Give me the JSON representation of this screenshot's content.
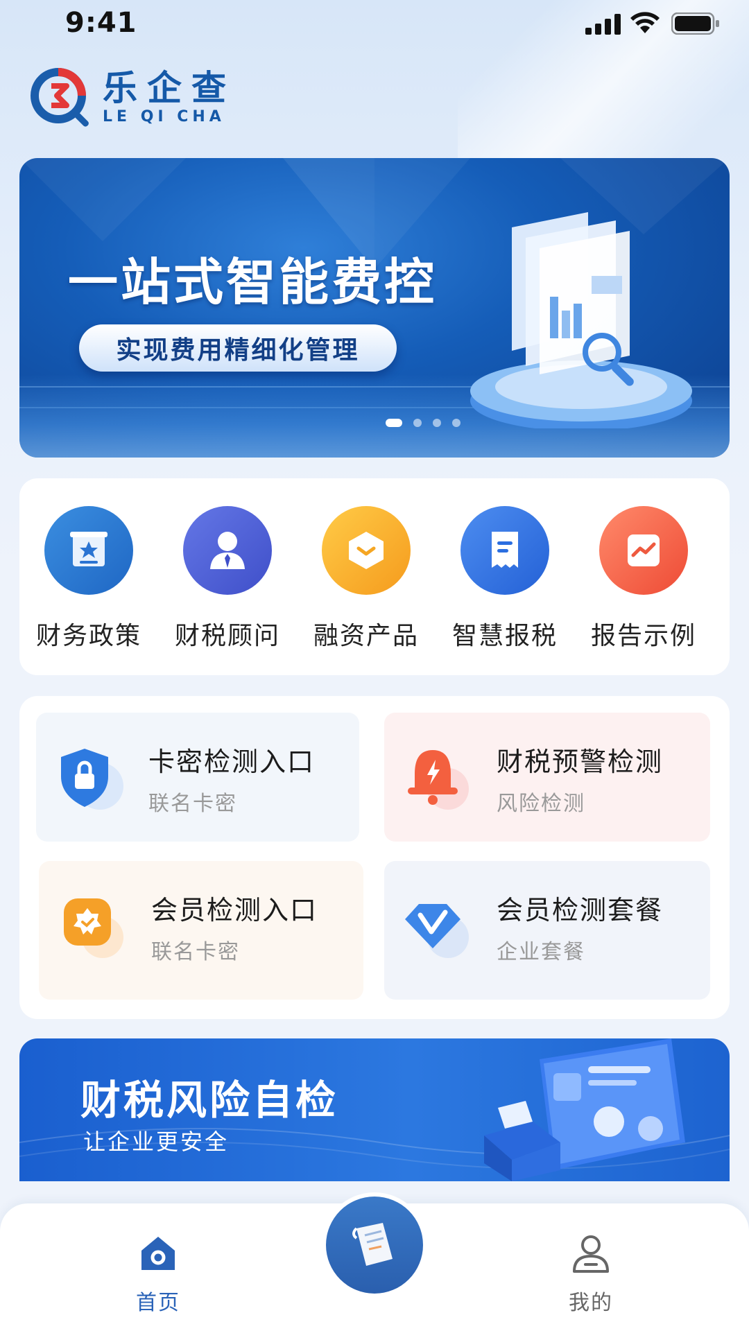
{
  "status_bar": {
    "time": "9:41"
  },
  "logo": {
    "cn": "乐企查",
    "en": "LE QI CHA"
  },
  "banner": {
    "title": "一站式智能费控",
    "subtitle": "实现费用精细化管理",
    "page_count": 4,
    "active_page": 1
  },
  "quick_menu": [
    {
      "label": "财务政策",
      "icon": "policy-certificate-icon"
    },
    {
      "label": "财税顾问",
      "icon": "consultant-person-icon"
    },
    {
      "label": "融资产品",
      "icon": "financing-box-icon"
    },
    {
      "label": "智慧报税",
      "icon": "tax-receipt-icon"
    },
    {
      "label": "报告示例",
      "icon": "report-chart-icon"
    }
  ],
  "features": [
    {
      "title": "卡密检测入口",
      "subtitle": "联名卡密",
      "icon": "lock-shield-icon"
    },
    {
      "title": "财税预警检测",
      "subtitle": "风险检测",
      "icon": "alarm-bell-icon"
    },
    {
      "title": "会员检测入口",
      "subtitle": "联名卡密",
      "icon": "member-badge-icon"
    },
    {
      "title": "会员检测套餐",
      "subtitle": "企业套餐",
      "icon": "diamond-vip-icon"
    }
  ],
  "promo": {
    "title": "财税风险自检",
    "subtitle": "让企业更安全"
  },
  "tab_bar": {
    "home_label": "首页",
    "mine_label": "我的",
    "active": "home",
    "active_color": "#2a63b8",
    "inactive_color": "#666666"
  },
  "colors": {
    "brand": "#1559a8",
    "accent": "#2a63b8"
  }
}
